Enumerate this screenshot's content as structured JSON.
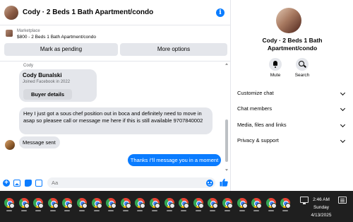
{
  "header": {
    "title": "Cody · 2 Beds 1 Bath Apartment/condo"
  },
  "marketplace": {
    "label": "Marketplace",
    "item": "$800 - 2 Beds 1 Bath Apartment/condo",
    "pending_label": "Mark as pending",
    "more_label": "More options"
  },
  "thread": {
    "sender_label": "Cody",
    "card": {
      "name": "Cody Bunalski",
      "joined": "Joined Facebook in 2022",
      "button_label": "Buyer details"
    },
    "messages": [
      {
        "from": "them",
        "text": "Hey I just got a sous chef position out in boca and definitely need to move in asap so pleasee call or message me here if this is still available 9707840002"
      },
      {
        "from": "them",
        "text": "Message sent"
      },
      {
        "from": "me",
        "text": "Thanks i\"ll message you in a moment"
      }
    ]
  },
  "composer": {
    "placeholder": "Aa"
  },
  "info_panel": {
    "title": "Cody · 2 Beds 1 Bath Apartment/condo",
    "actions": {
      "mute": "Mute",
      "search": "Search"
    },
    "rows": {
      "customize": "Customize chat",
      "members": "Chat members",
      "media": "Media, files and links",
      "privacy": "Privacy & support"
    }
  },
  "taskbar": {
    "app_count": 20,
    "app_icon": "chrome-icon",
    "clock": {
      "time": "2:46 AM",
      "day": "Sunday",
      "date": "4/13/2025"
    }
  },
  "colors": {
    "accent": "#0a7cff",
    "bubble_other": "#e4e6eb",
    "taskbar": "#1f1f1f"
  }
}
